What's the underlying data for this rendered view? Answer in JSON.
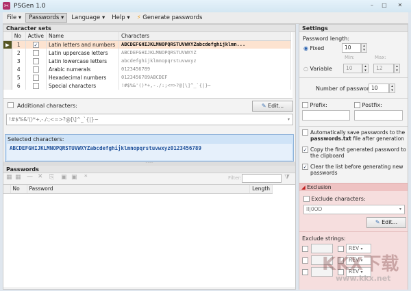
{
  "window": {
    "title": "PSGen 1.0",
    "controls": [
      "–",
      "□",
      "✕"
    ]
  },
  "menu": {
    "file": "File ▾",
    "passwords": "Passwords ▾",
    "language": "Language ▾",
    "help": "Help ▾",
    "generate": "Generate passwords"
  },
  "charsets": {
    "header": "Character sets",
    "columns": [
      "No",
      "Active",
      "Name",
      "Characters"
    ],
    "rows": [
      {
        "no": "1",
        "active": true,
        "name": "Latin letters and numbers",
        "chars": "ABCDEFGHIJKLMNOPQRSTUVWXYZabcdefghijklmn..."
      },
      {
        "no": "2",
        "active": false,
        "name": "Latin uppercase letters",
        "chars": "ABCDEFGHIJKLMNOPQRSTUVWXYZ"
      },
      {
        "no": "3",
        "active": false,
        "name": "Latin lowercase letters",
        "chars": "abcdefghijklmnopqrstuvwxyz"
      },
      {
        "no": "4",
        "active": false,
        "name": "Arabic numerals",
        "chars": "0123456789"
      },
      {
        "no": "5",
        "active": false,
        "name": "Hexadecimal numbers",
        "chars": "0123456789ABCDEF"
      },
      {
        "no": "6",
        "active": false,
        "name": "Special characters",
        "chars": "!#$%&'()*+,-./:;<=>?@[\\]^_`{|}~"
      }
    ]
  },
  "additional": {
    "label": "Additional characters:",
    "edit": "Edit...",
    "value": "!#$%&'()*+,-./:;<=>?@[\\]^_`{|}~"
  },
  "selected": {
    "label": "Selected characters:",
    "value": "ABCDEFGHIJKLMNOPQRSTUVWXYZabcdefghijklmnopqrstuvwxyz0123456789"
  },
  "passwords": {
    "header": "Passwords",
    "filter_label": "Filter:",
    "columns": [
      "No",
      "Password",
      "Length"
    ]
  },
  "settings": {
    "header": "Settings",
    "length_label": "Password length:",
    "fixed": "Fixed",
    "fixed_value": "10",
    "variable": "Variable",
    "min_label": "Min:",
    "max_label": "Max:",
    "min": "10",
    "max": "12",
    "count_label": "Number of passwords:",
    "count": "10",
    "prefix": "Prefix:",
    "postfix": "Postfix:",
    "autosave_a": "Automatically save passwords to the ",
    "autosave_b": "passwords.txt",
    "autosave_c": " file after generation",
    "copy": "Copy the first generated password to the clipboard",
    "clear": "Clear the list before generating new passwords"
  },
  "exclusion": {
    "header": "Exclusion",
    "chars_label": "Exclude characters:",
    "chars_value": "Il|0OD",
    "edit": "Edit...",
    "strings_label": "Exclude strings:",
    "rev": "REV"
  },
  "watermark": {
    "brand": "KKX下载",
    "url": "www.kkx.net"
  }
}
